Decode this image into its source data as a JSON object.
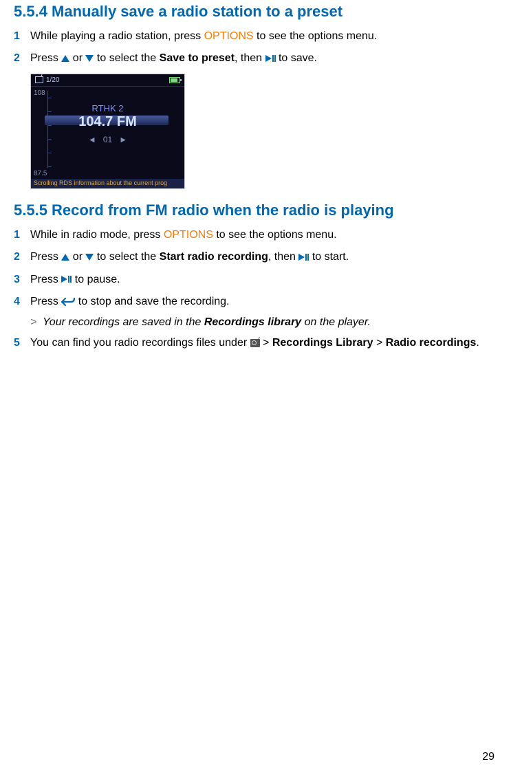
{
  "section_5_5_4": {
    "heading": "5.5.4 Manually save a radio station to a preset",
    "step1": {
      "pre": "While playing a radio station, press ",
      "options": "OPTIONS",
      "post": " to see the options menu."
    },
    "step2": {
      "a": "Press ",
      "b": " or ",
      "c": " to select the ",
      "d": "Save to preset",
      "e": ", then ",
      "f": " to save."
    },
    "screenshot": {
      "counter": "1/20",
      "hi": "108",
      "lo": "87.5",
      "station": "RTHK 2",
      "freq": "104.7 FM",
      "preset_left": "◄",
      "preset_num": "01",
      "preset_right": "►",
      "scroll": "Scrolling RDS information about the current prog"
    }
  },
  "section_5_5_5": {
    "heading": "5.5.5 Record from FM radio when the radio is playing",
    "step1": {
      "pre": "While in radio mode, press ",
      "options": "OPTIONS",
      "post": " to see the options menu."
    },
    "step2": {
      "a": "Press ",
      "b": " or ",
      "c": " to select the ",
      "d": "Start radio recording",
      "e": ", then ",
      "f": " to start."
    },
    "step3": {
      "a": "Press ",
      "b": " to pause."
    },
    "step4": {
      "a": "Press ",
      "b": " to stop and save the recording."
    },
    "note": {
      "a": "Your recordings are saved in the ",
      "b": "Recordings library",
      "c": " on the player."
    },
    "step5": {
      "a": "You can find you radio recordings files under ",
      "b": " > ",
      "c": "Recordings Library",
      "d": " > ",
      "e": "Radio recordings",
      "f": "."
    }
  },
  "step_numbers": {
    "n1": "1",
    "n2": "2",
    "n3": "3",
    "n4": "4",
    "n5": "5",
    "gt": ">"
  },
  "page_number": "29"
}
